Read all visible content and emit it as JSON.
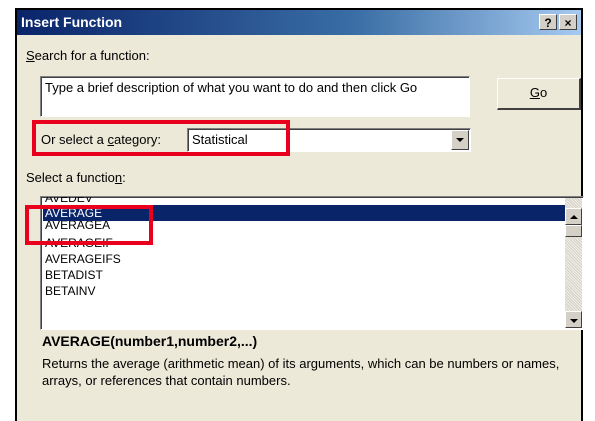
{
  "dialog": {
    "title": "Insert Function",
    "help_button": "?",
    "close_button": "×"
  },
  "search": {
    "label_underlined": "S",
    "label_rest": "earch for a function:",
    "value": "Type a brief description of what you want to do and then click Go",
    "go_button_underlined": "G",
    "go_button_rest": "o"
  },
  "category": {
    "label_before": "Or select a ",
    "label_underlined": "c",
    "label_after": "ategory:",
    "selected": "Statistical"
  },
  "function_list": {
    "label_before": "Select a functio",
    "label_underlined": "n",
    "label_after": ":",
    "items": [
      "AVEDEV",
      "AVERAGE",
      "AVERAGEA",
      "AVERAGEIF",
      "AVERAGEIFS",
      "BETADIST",
      "BETAINV"
    ],
    "selected_index": 1
  },
  "details": {
    "signature": "AVERAGE(number1,number2,...)",
    "description": "Returns the average (arithmetic mean) of its arguments, which can be numbers or names, arrays, or references that contain numbers."
  },
  "colors": {
    "highlight": "#e8001c",
    "selection": "#0a246a",
    "title_bar": "#0a246a"
  },
  "icons": [
    "help-icon",
    "close-icon",
    "chevron-down-icon",
    "chevron-up-icon"
  ]
}
